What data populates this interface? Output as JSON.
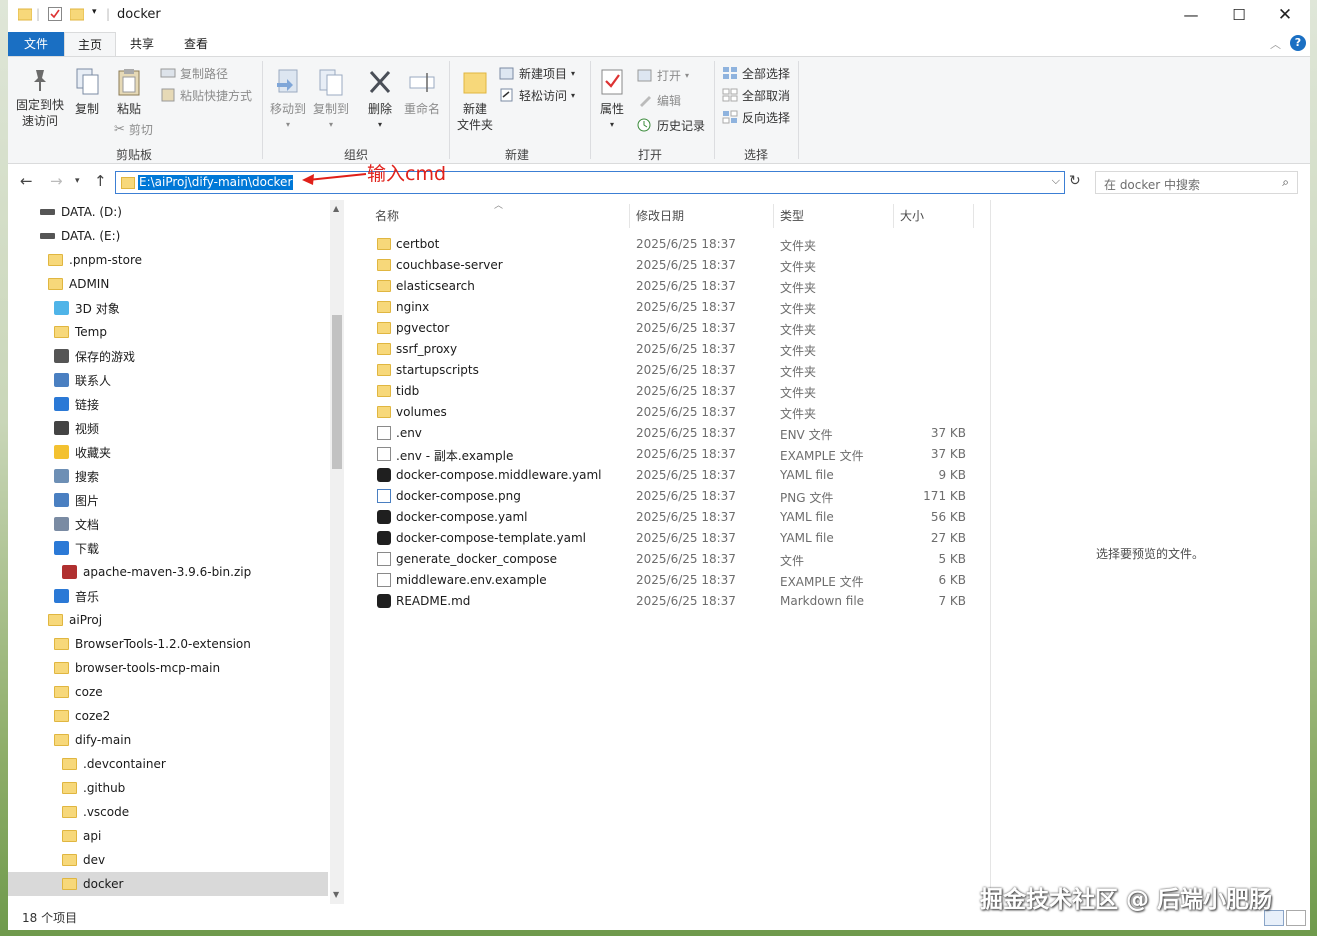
{
  "window": {
    "title": "docker",
    "controls": [
      "minimize-icon",
      "maximize-icon",
      "close-icon"
    ]
  },
  "ribbon_tabs": [
    "文件",
    "主页",
    "共享",
    "查看"
  ],
  "ribbon": {
    "clipboard": {
      "label": "剪贴板",
      "pin": "固定到快\n速访问",
      "copy": "复制",
      "paste": "粘贴",
      "copy_path": "复制路径",
      "paste_shortcut": "粘贴快捷方式",
      "cut": "剪切"
    },
    "organize": {
      "label": "组织",
      "move_to": "移动到",
      "copy_to": "复制到",
      "delete": "删除",
      "rename": "重命名"
    },
    "new": {
      "label": "新建",
      "new_folder": "新建\n文件夹",
      "new_item": "新建项目",
      "easy_access": "轻松访问"
    },
    "open": {
      "label": "打开",
      "properties": "属性",
      "open": "打开",
      "edit": "编辑",
      "history": "历史记录"
    },
    "select": {
      "label": "选择",
      "select_all": "全部选择",
      "select_none": "全部取消",
      "invert": "反向选择"
    }
  },
  "address": {
    "path": "E:\\aiProj\\dify-main\\docker",
    "search_placeholder": "在 docker 中搜索",
    "annotation": "输入cmd"
  },
  "tree": [
    {
      "label": "DATA. (D:)",
      "icon": "drive-icon",
      "indent": 0
    },
    {
      "label": "DATA. (E:)",
      "icon": "drive-icon",
      "indent": 0
    },
    {
      "label": ".pnpm-store",
      "icon": "folder-icon",
      "indent": 1
    },
    {
      "label": "ADMIN",
      "icon": "folder-icon",
      "indent": 1
    },
    {
      "label": "3D 对象",
      "icon": "cube-icon",
      "indent": 2
    },
    {
      "label": "Temp",
      "icon": "folder-icon",
      "indent": 2
    },
    {
      "label": "保存的游戏",
      "icon": "game-icon",
      "indent": 2
    },
    {
      "label": "联系人",
      "icon": "contacts-icon",
      "indent": 2
    },
    {
      "label": "链接",
      "icon": "link-icon",
      "indent": 2
    },
    {
      "label": "视频",
      "icon": "video-icon",
      "indent": 2
    },
    {
      "label": "收藏夹",
      "icon": "star-icon",
      "indent": 2
    },
    {
      "label": "搜索",
      "icon": "search-icon",
      "indent": 2
    },
    {
      "label": "图片",
      "icon": "picture-icon",
      "indent": 2
    },
    {
      "label": "文档",
      "icon": "document-icon",
      "indent": 2
    },
    {
      "label": "下载",
      "icon": "download-icon",
      "indent": 2
    },
    {
      "label": "apache-maven-3.9.6-bin.zip",
      "icon": "archive-icon",
      "indent": 3
    },
    {
      "label": "音乐",
      "icon": "music-icon",
      "indent": 2
    },
    {
      "label": "aiProj",
      "icon": "folder-icon",
      "indent": 1
    },
    {
      "label": "BrowserTools-1.2.0-extension",
      "icon": "folder-icon",
      "indent": 2
    },
    {
      "label": "browser-tools-mcp-main",
      "icon": "folder-icon",
      "indent": 2
    },
    {
      "label": "coze",
      "icon": "folder-icon",
      "indent": 2
    },
    {
      "label": "coze2",
      "icon": "folder-icon",
      "indent": 2
    },
    {
      "label": "dify-main",
      "icon": "folder-icon",
      "indent": 2
    },
    {
      "label": ".devcontainer",
      "icon": "folder-icon",
      "indent": 3
    },
    {
      "label": ".github",
      "icon": "folder-icon",
      "indent": 3
    },
    {
      "label": ".vscode",
      "icon": "folder-icon",
      "indent": 3
    },
    {
      "label": "api",
      "icon": "folder-icon",
      "indent": 3
    },
    {
      "label": "dev",
      "icon": "folder-icon",
      "indent": 3
    },
    {
      "label": "docker",
      "icon": "folder-icon",
      "indent": 3,
      "selected": true
    }
  ],
  "columns": {
    "name": "名称",
    "date": "修改日期",
    "type": "类型",
    "size": "大小"
  },
  "files": [
    {
      "name": "certbot",
      "date": "2025/6/25 18:37",
      "type": "文件夹",
      "size": "",
      "icon": "folder"
    },
    {
      "name": "couchbase-server",
      "date": "2025/6/25 18:37",
      "type": "文件夹",
      "size": "",
      "icon": "folder"
    },
    {
      "name": "elasticsearch",
      "date": "2025/6/25 18:37",
      "type": "文件夹",
      "size": "",
      "icon": "folder"
    },
    {
      "name": "nginx",
      "date": "2025/6/25 18:37",
      "type": "文件夹",
      "size": "",
      "icon": "folder"
    },
    {
      "name": "pgvector",
      "date": "2025/6/25 18:37",
      "type": "文件夹",
      "size": "",
      "icon": "folder"
    },
    {
      "name": "ssrf_proxy",
      "date": "2025/6/25 18:37",
      "type": "文件夹",
      "size": "",
      "icon": "folder"
    },
    {
      "name": "startupscripts",
      "date": "2025/6/25 18:37",
      "type": "文件夹",
      "size": "",
      "icon": "folder"
    },
    {
      "name": "tidb",
      "date": "2025/6/25 18:37",
      "type": "文件夹",
      "size": "",
      "icon": "folder"
    },
    {
      "name": "volumes",
      "date": "2025/6/25 18:37",
      "type": "文件夹",
      "size": "",
      "icon": "folder"
    },
    {
      "name": ".env",
      "date": "2025/6/25 18:37",
      "type": "ENV 文件",
      "size": "37 KB",
      "icon": "doc"
    },
    {
      "name": ".env - 副本.example",
      "date": "2025/6/25 18:37",
      "type": "EXAMPLE 文件",
      "size": "37 KB",
      "icon": "doc"
    },
    {
      "name": "docker-compose.middleware.yaml",
      "date": "2025/6/25 18:37",
      "type": "YAML file",
      "size": "9 KB",
      "icon": "dark"
    },
    {
      "name": "docker-compose.png",
      "date": "2025/6/25 18:37",
      "type": "PNG 文件",
      "size": "171 KB",
      "icon": "img"
    },
    {
      "name": "docker-compose.yaml",
      "date": "2025/6/25 18:37",
      "type": "YAML file",
      "size": "56 KB",
      "icon": "dark"
    },
    {
      "name": "docker-compose-template.yaml",
      "date": "2025/6/25 18:37",
      "type": "YAML file",
      "size": "27 KB",
      "icon": "dark"
    },
    {
      "name": "generate_docker_compose",
      "date": "2025/6/25 18:37",
      "type": "文件",
      "size": "5 KB",
      "icon": "doc"
    },
    {
      "name": "middleware.env.example",
      "date": "2025/6/25 18:37",
      "type": "EXAMPLE 文件",
      "size": "6 KB",
      "icon": "doc"
    },
    {
      "name": "README.md",
      "date": "2025/6/25 18:37",
      "type": "Markdown file",
      "size": "7 KB",
      "icon": "dark"
    }
  ],
  "preview_text": "选择要预览的文件。",
  "status": {
    "count": "18 个项目"
  },
  "watermark": "掘金技术社区 @ 后端小肥肠",
  "colors": {
    "accent": "#1a6fc3",
    "selection": "#0078d7",
    "annotation": "#e0201a",
    "folder": "#f7d87a"
  }
}
